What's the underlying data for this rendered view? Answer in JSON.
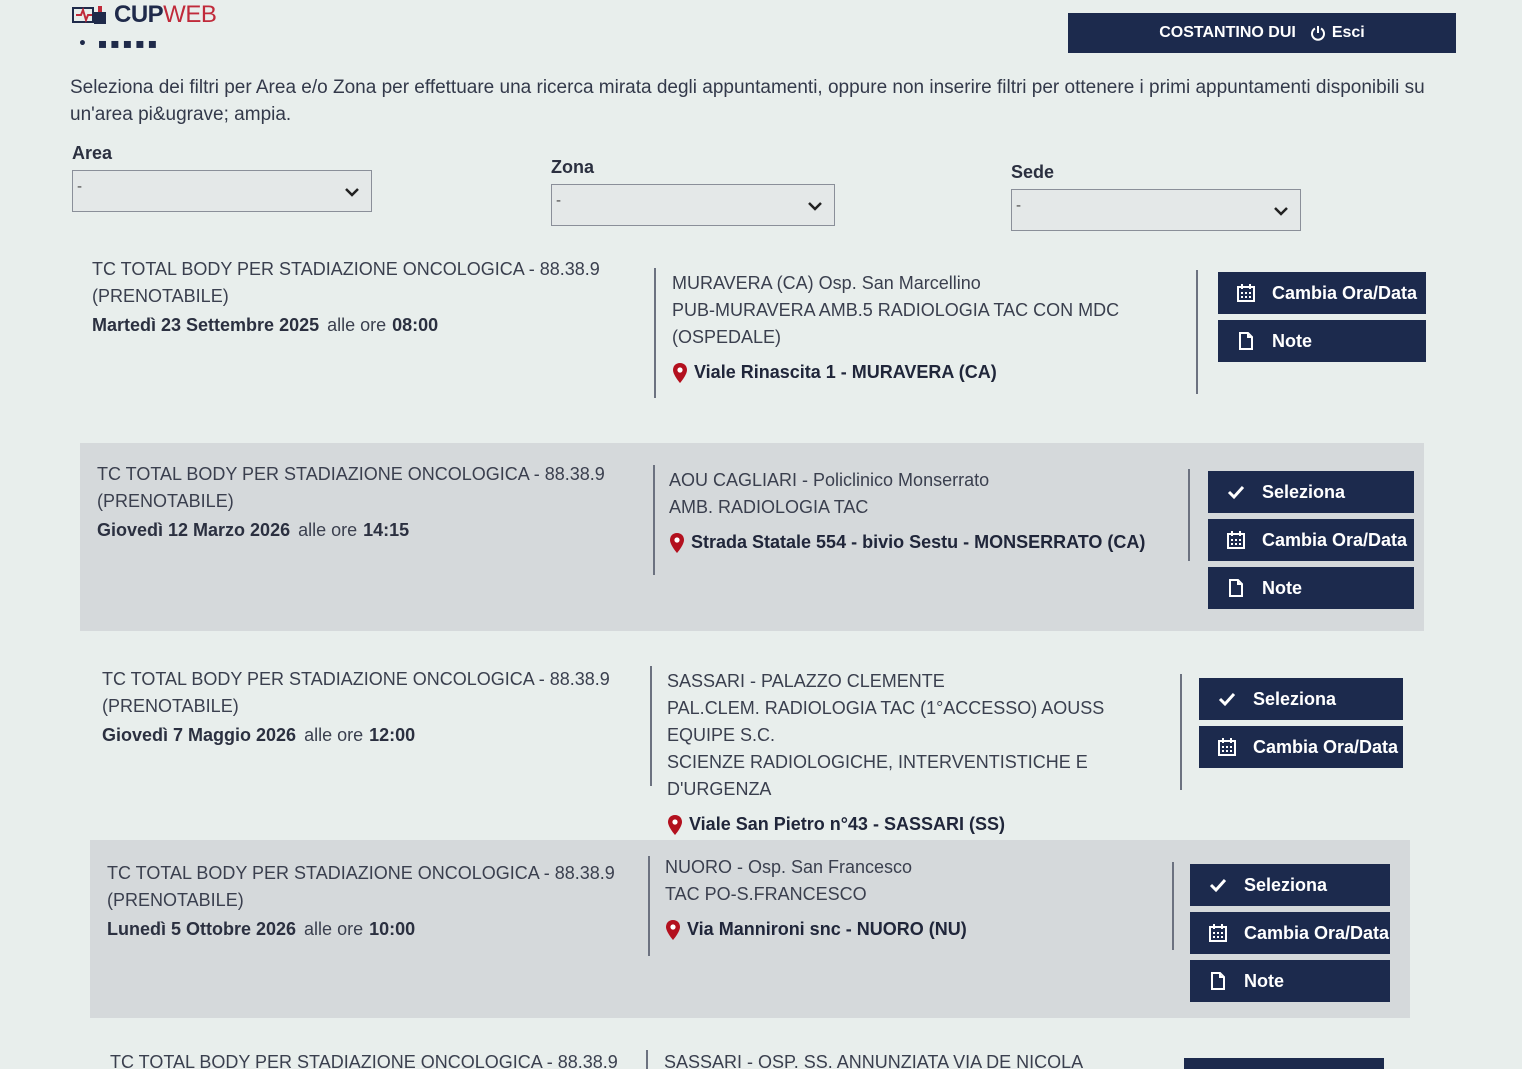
{
  "header": {
    "logo_cup": "CUP",
    "logo_web": "WEB",
    "logo_tagline": "• ▪▪▪▪▪",
    "user_name": "COSTANTINO DUI",
    "logout_label": "Esci"
  },
  "intro": "Seleziona dei filtri per Area e/o Zona per effettuare una ricerca mirata degli appuntamenti, oppure non inserire filtri per ottenere i primi appuntamenti disponibili su un'area pi&ugrave; ampia.",
  "filters": {
    "area": {
      "label": "Area",
      "value": "-"
    },
    "zona": {
      "label": "Zona",
      "value": "-"
    },
    "sede": {
      "label": "Sede",
      "value": "-"
    }
  },
  "appointments": [
    {
      "exam": "TC TOTAL BODY PER STADIAZIONE ONCOLOGICA - 88.38.9",
      "status": "(PRENOTABILE)",
      "date": "Martedì 23 Settembre 2025",
      "at_label": "alle ore",
      "time": "08:00",
      "place_lines": [
        "MURAVERA (CA) Osp. San Marcellino",
        "PUB-MURAVERA AMB.5 RADIOLOGIA TAC CON MDC",
        "(OSPEDALE)"
      ],
      "address": "Viale Rinascita 1 - MURAVERA (CA)",
      "buttons": [
        {
          "label": "Cambia Ora/Data",
          "icon": "calendar-icon"
        },
        {
          "label": "Note",
          "icon": "document-icon"
        }
      ]
    },
    {
      "exam": "TC TOTAL BODY PER STADIAZIONE ONCOLOGICA - 88.38.9",
      "status": "(PRENOTABILE)",
      "date": "Giovedì 12 Marzo 2026",
      "at_label": "alle ore",
      "time": "14:15",
      "place_lines": [
        "AOU CAGLIARI - Policlinico Monserrato",
        "AMB. RADIOLOGIA TAC"
      ],
      "address": "Strada Statale 554 - bivio Sestu - MONSERRATO (CA)",
      "buttons": [
        {
          "label": "Seleziona",
          "icon": "check-icon"
        },
        {
          "label": "Cambia Ora/Data",
          "icon": "calendar-icon"
        },
        {
          "label": "Note",
          "icon": "document-icon"
        }
      ]
    },
    {
      "exam": "TC TOTAL BODY PER STADIAZIONE ONCOLOGICA - 88.38.9",
      "status": "(PRENOTABILE)",
      "date": "Giovedì 7 Maggio 2026",
      "at_label": "alle ore",
      "time": "12:00",
      "place_lines": [
        "SASSARI - PALAZZO CLEMENTE",
        "PAL.CLEM. RADIOLOGIA TAC (1°ACCESSO) AOUSS EQUIPE S.C.",
        "SCIENZE RADIOLOGICHE, INTERVENTISTICHE E D'URGENZA"
      ],
      "address": "Viale San Pietro n°43 - SASSARI (SS)",
      "buttons": [
        {
          "label": "Seleziona",
          "icon": "check-icon"
        },
        {
          "label": "Cambia Ora/Data",
          "icon": "calendar-icon"
        }
      ]
    },
    {
      "exam": "TC TOTAL BODY PER STADIAZIONE ONCOLOGICA - 88.38.9",
      "status": "(PRENOTABILE)",
      "date": "Lunedì 5 Ottobre 2026",
      "at_label": "alle ore",
      "time": "10:00",
      "place_lines": [
        "NUORO - Osp. San Francesco",
        "TAC PO-S.FRANCESCO"
      ],
      "address": "Via Mannironi snc - NUORO (NU)",
      "buttons": [
        {
          "label": "Seleziona",
          "icon": "check-icon"
        },
        {
          "label": "Cambia Ora/Data",
          "icon": "calendar-icon"
        },
        {
          "label": "Note",
          "icon": "document-icon"
        }
      ]
    }
  ],
  "partial_row": {
    "exam": "TC TOTAL BODY PER STADIAZIONE ONCOLOGICA - 88.38.9",
    "place": "SASSARI - OSP. SS. ANNUNZIATA VIA DE NICOLA"
  }
}
